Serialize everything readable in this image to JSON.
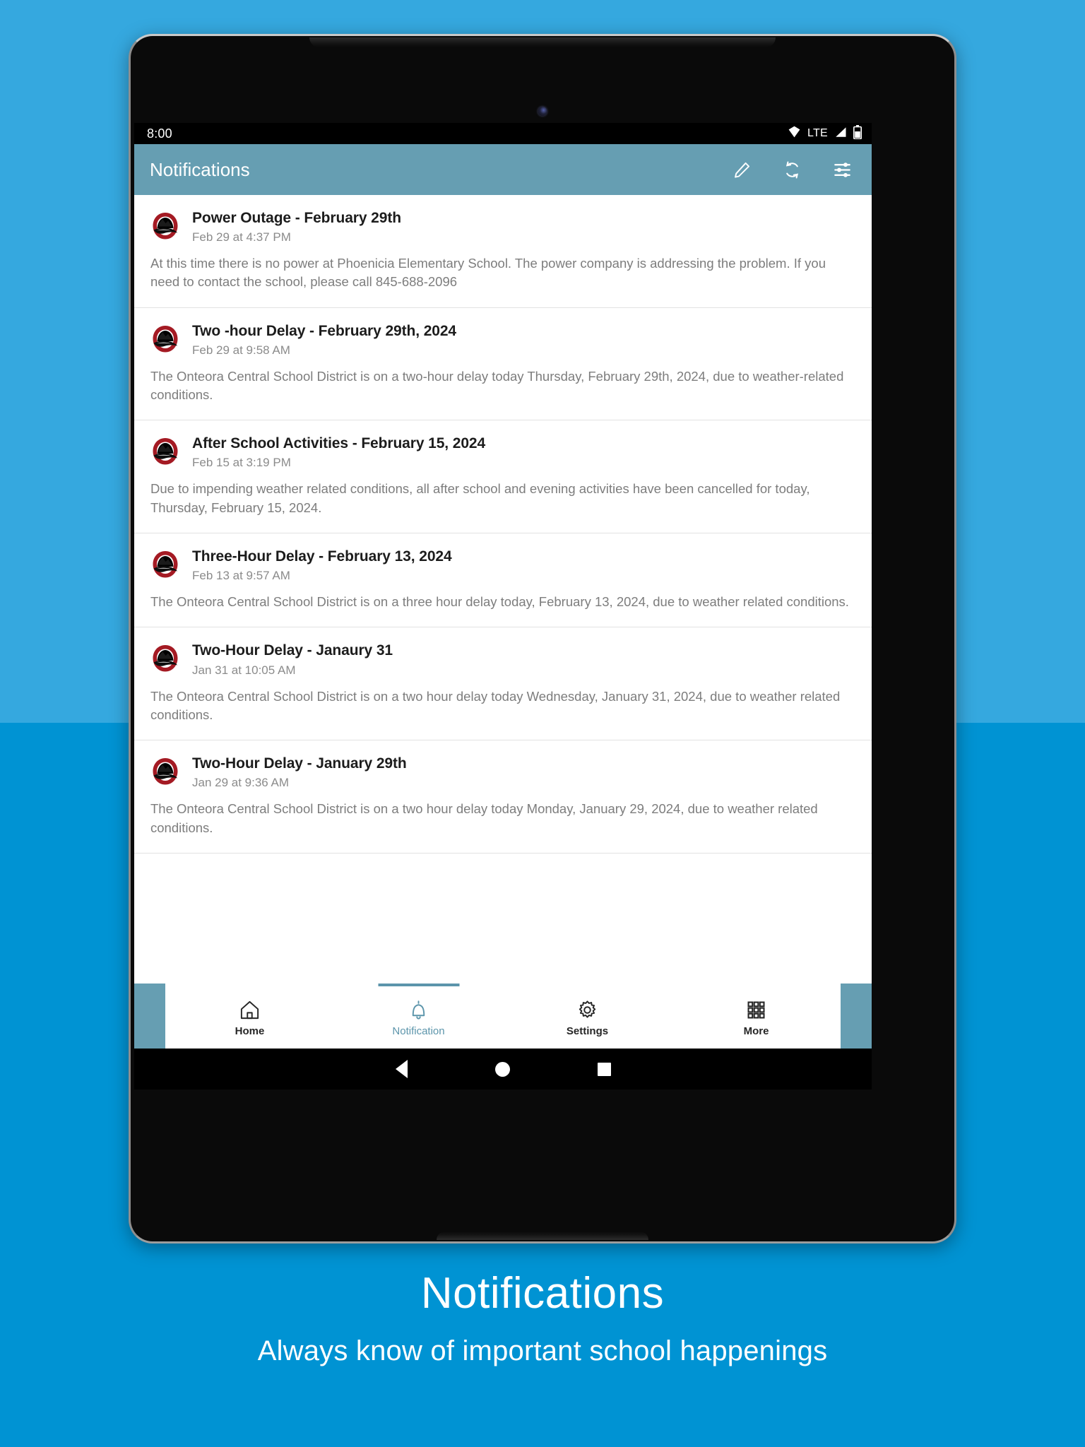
{
  "background": {
    "top_color": "#35a8df",
    "bottom_color": "#0093d3"
  },
  "status_bar": {
    "time": "8:00",
    "network_label": "LTE",
    "icons": [
      "wifi-icon",
      "signal-icon",
      "battery-icon"
    ]
  },
  "app_bar": {
    "title": "Notifications",
    "accent_color": "#669eb2",
    "actions": [
      {
        "name": "edit-icon",
        "label": "Edit"
      },
      {
        "name": "refresh-icon",
        "label": "Refresh"
      },
      {
        "name": "filter-icon",
        "label": "Filter"
      }
    ]
  },
  "notifications": [
    {
      "title": "Power Outage - February 29th",
      "time": "Feb 29 at 4:37 PM",
      "body": "At this time there is no power at Phoenicia Elementary School.  The power company is addressing the problem.  If you need to contact the school, please call 845-688-2096"
    },
    {
      "title": "Two -hour Delay - February 29th, 2024",
      "time": "Feb 29 at 9:58 AM",
      "body": "The Onteora Central School District is on a two-hour delay today Thursday, February 29th, 2024, due to weather-related conditions."
    },
    {
      "title": "After School Activities - February 15, 2024",
      "time": "Feb 15 at 3:19 PM",
      "body": "Due to impending weather related conditions, all after school and evening activities have been cancelled for today, Thursday, February 15, 2024."
    },
    {
      "title": "Three-Hour Delay - February 13, 2024",
      "time": "Feb 13 at 9:57 AM",
      "body": "The Onteora Central School District is on a three hour delay today, February 13, 2024,  due to weather related conditions."
    },
    {
      "title": "Two-Hour Delay - Janaury 31",
      "time": "Jan 31 at 10:05 AM",
      "body": "The Onteora Central School District is on a two hour delay today Wednesday, January 31, 2024, due to weather related conditions."
    },
    {
      "title": "Two-Hour Delay - January 29th",
      "time": "Jan 29 at 9:36 AM",
      "body": "The Onteora Central School District is on a two hour delay today Monday, January 29, 2024, due to weather related conditions."
    }
  ],
  "tab_bar": {
    "active_color": "#5c95ab",
    "items": [
      {
        "label": "Home",
        "icon": "home-icon",
        "active": false
      },
      {
        "label": "Notification",
        "icon": "bell-icon",
        "active": true
      },
      {
        "label": "Settings",
        "icon": "gear-icon",
        "active": false
      },
      {
        "label": "More",
        "icon": "grid-icon",
        "active": false
      }
    ]
  },
  "android_nav": {
    "back": "back-triangle-icon",
    "home": "home-circle-icon",
    "recents": "recents-square-icon"
  },
  "caption": {
    "title": "Notifications",
    "subtitle": "Always know of important school happenings"
  }
}
